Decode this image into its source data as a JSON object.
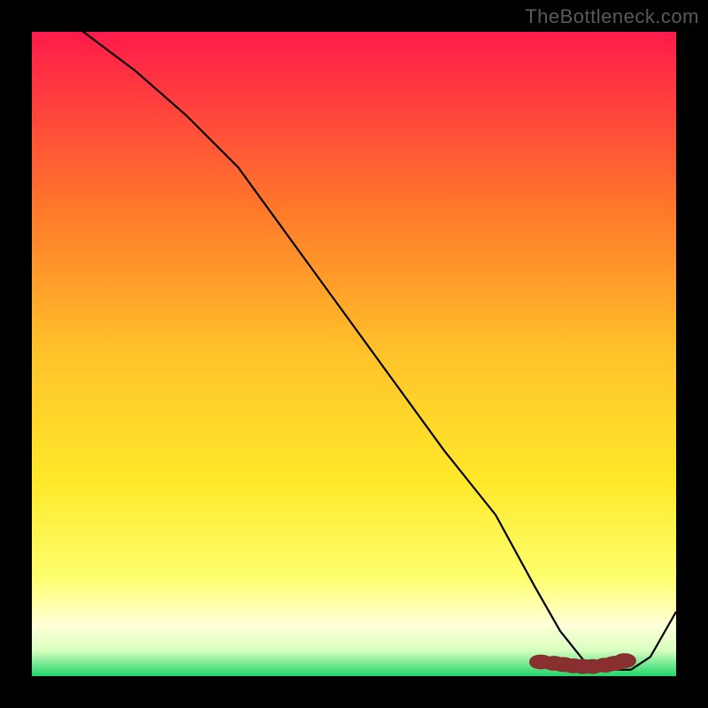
{
  "watermark": "TheBottleneck.com",
  "colors": {
    "gradient_top": "#ff1a4a",
    "gradient_upper_mid": "#ff9a2a",
    "gradient_mid": "#ffe92a",
    "gradient_pale": "#ffffc0",
    "gradient_bottom": "#1fd66a",
    "curve": "#000000",
    "marker_fill": "#ce4b4b",
    "marker_stroke": "#8a2f2f",
    "background": "#000000"
  },
  "chart_data": {
    "type": "line",
    "title": "",
    "xlabel": "",
    "ylabel": "",
    "xlim": [
      0,
      100
    ],
    "ylim": [
      0,
      100
    ],
    "grid": false,
    "legend": false,
    "series": [
      {
        "name": "curve",
        "x": [
          0,
          8,
          16,
          24,
          32,
          40,
          48,
          56,
          64,
          72,
          78,
          82,
          86,
          90,
          93,
          96,
          100
        ],
        "values": [
          107,
          100,
          94,
          87,
          79,
          68,
          57,
          46,
          35,
          25,
          14,
          7,
          2,
          1,
          1,
          3,
          10
        ]
      }
    ],
    "markers": {
      "x": [
        79,
        81,
        82.5,
        84,
        85.5,
        87,
        89,
        90.5,
        92
      ],
      "y": [
        2.2,
        2.0,
        1.8,
        1.6,
        1.5,
        1.5,
        1.7,
        2.0,
        2.4
      ]
    }
  }
}
